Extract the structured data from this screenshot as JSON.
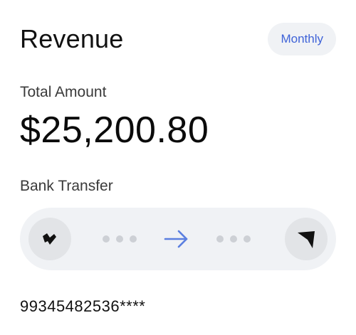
{
  "header": {
    "title": "Revenue",
    "period_button": "Monthly"
  },
  "total": {
    "label": "Total Amount",
    "amount": "$25,200.80"
  },
  "transfer": {
    "method_label": "Bank Transfer",
    "from_icon": "bank-logo-icon",
    "to_icon": "send-cursor-icon",
    "arrow_icon": "arrow-right-icon",
    "arrow_color": "#5b7fe0",
    "account_number": "99345482536****"
  },
  "colors": {
    "accent": "#3f63d8",
    "pill_background": "#f0f2f5",
    "circle_background": "#e2e4e7"
  }
}
